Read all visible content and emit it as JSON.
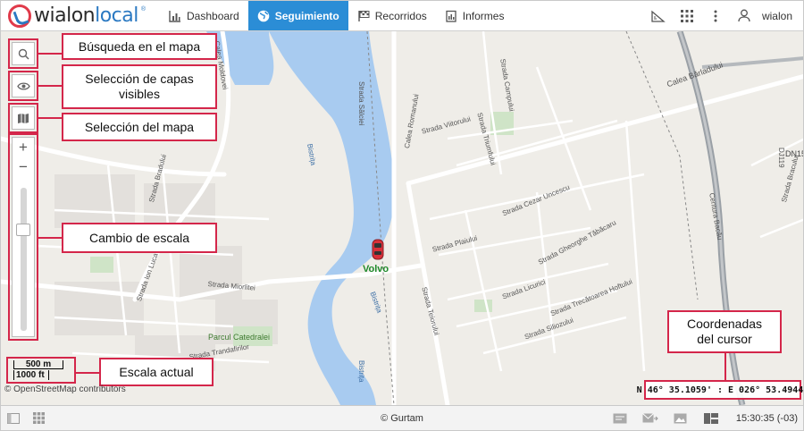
{
  "brand": {
    "name_a": "wialon",
    "name_b": "local"
  },
  "nav": [
    {
      "label": "Dashboard",
      "icon": "chart-icon"
    },
    {
      "label": "Seguimiento",
      "icon": "globe-icon",
      "active": true
    },
    {
      "label": "Recorridos",
      "icon": "flag-icon"
    },
    {
      "label": "Informes",
      "icon": "report-icon"
    }
  ],
  "user": {
    "name": "wialon"
  },
  "map": {
    "unit_label": "Volvo",
    "river_name": "Bistrița",
    "park_name": "Parcul Catedralei",
    "streets": [
      "Calea Moldovei",
      "Strada Sălciei",
      "Strada Campului",
      "Strada Viitorului",
      "Strada Triumfului",
      "Calea Bărladului",
      "Calea Romanului",
      "Strada Cezar Uncescu",
      "Strada Plaiului",
      "Strada Gheorghe Tăbăcaru",
      "Strada Licurici",
      "Strada Trecătoarea Hoftului",
      "Strada Siliozului",
      "Strada Teiorului",
      "Strada Miorlitei",
      "Strada Trandafirilor",
      "Strada Bradului",
      "Strada Ion Luca",
      "Centura Bacău",
      "DJ119",
      "Strada Bracului",
      "DN15"
    ],
    "scale_metric": "500 m",
    "scale_imperial": "1000 ft",
    "attribution": "© OpenStreetMap contributors",
    "coordinates": "N 46° 35.1059' : E 026° 53.4944'"
  },
  "callouts": {
    "search": "Búsqueda en el mapa",
    "layers": "Selección de capas visibles",
    "map_select": "Selección del mapa",
    "zoom": "Cambio de escala",
    "scale": "Escala actual",
    "cursor": "Coordenadas del cursor"
  },
  "footer": {
    "copyright": "© Gurtam",
    "time": "15:30:35 (-03)"
  },
  "colors": {
    "accent": "#2b8dd6",
    "callout_border": "#d4264a",
    "unit_label": "#1f8a2b",
    "water": "#a8cbf0"
  }
}
